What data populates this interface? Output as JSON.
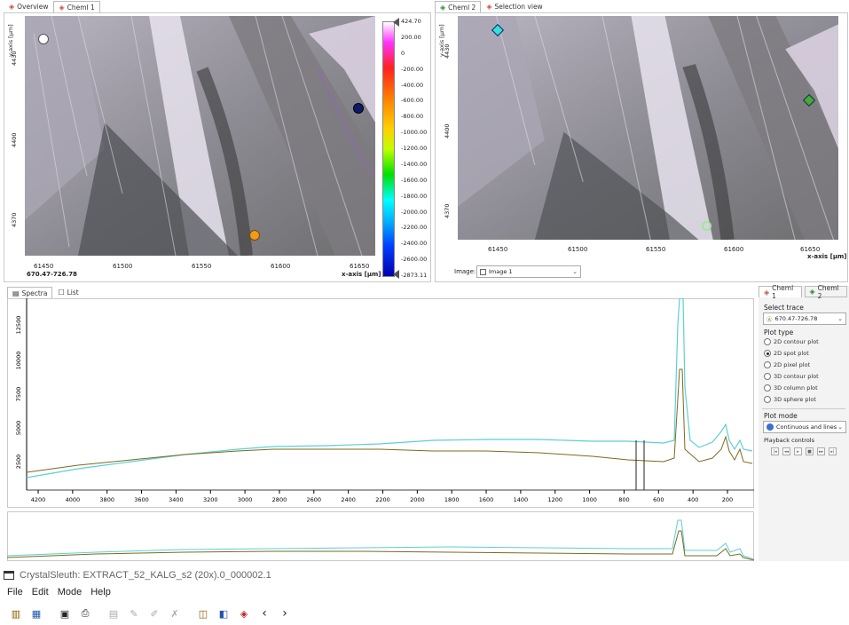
{
  "left_panel": {
    "tabs": [
      {
        "label": "Overview",
        "active": false
      },
      {
        "label": "Cheml 1",
        "active": true
      }
    ],
    "y_axis_label": "y-axis [µm]",
    "y_ticks": [
      "4430",
      "4400",
      "4370"
    ],
    "x_ticks": [
      "61450",
      "61500",
      "61550",
      "61600",
      "61650"
    ],
    "x_axis_label": "x-axis [µm]",
    "cursor_readout": "670.47-726.78",
    "colorbar_labels": [
      "424.70",
      "200.00",
      "0",
      "-200.00",
      "-400.00",
      "-600.00",
      "-800.00",
      "-1000.00",
      "-1200.00",
      "-1400.00",
      "-1600.00",
      "-1800.00",
      "-2000.00",
      "-2200.00",
      "-2400.00",
      "-2600.00",
      "-2873.11"
    ]
  },
  "right_panel": {
    "tabs": [
      {
        "label": "Cheml 2",
        "active": true
      },
      {
        "label": "Selection view",
        "active": false
      }
    ],
    "y_axis_label": "y-axis [µm]",
    "y_ticks": [
      "4430",
      "4400",
      "4370"
    ],
    "x_ticks": [
      "61450",
      "61500",
      "61550",
      "61600",
      "61650"
    ],
    "x_axis_label": "x-axis [µm]",
    "image_label": "Image:",
    "image_select": "Image 1"
  },
  "spectra_panel": {
    "tabs": [
      {
        "label": "Spectra",
        "active": true
      },
      {
        "label": "List",
        "active": false
      }
    ],
    "y_ticks": [
      "12500",
      "10000",
      "7500",
      "5000",
      "2500"
    ],
    "x_ticks": [
      "4200",
      "4000",
      "3800",
      "3600",
      "3400",
      "3200",
      "3000",
      "2800",
      "2600",
      "2400",
      "2200",
      "2000",
      "1800",
      "1600",
      "1400",
      "1200",
      "1000",
      "800",
      "600",
      "400",
      "200"
    ]
  },
  "side_panel": {
    "tabs": [
      {
        "label": "Cheml 1",
        "active": true
      },
      {
        "label": "Cheml 2",
        "active": false
      }
    ],
    "select_trace_label": "Select trace",
    "selected_trace": "670.47-726.78",
    "plot_type_label": "Plot type",
    "plot_types": [
      {
        "label": "2D contour plot",
        "checked": false
      },
      {
        "label": "2D spot plot",
        "checked": true
      },
      {
        "label": "2D pixel plot",
        "checked": false
      },
      {
        "label": "3D contour plot",
        "checked": false
      },
      {
        "label": "3D column plot",
        "checked": false
      },
      {
        "label": "3D sphere plot",
        "checked": false
      }
    ],
    "plot_mode_label": "Plot mode",
    "plot_mode": "Continuous and lines",
    "playback_label": "Playback controls"
  },
  "window": {
    "title": "CrystalSleuth: EXTRACT_52_KALG_s2 (20x).0_000002.1"
  },
  "menu": [
    "File",
    "Edit",
    "Mode",
    "Help"
  ],
  "colors": {
    "trace_cyan": "#5ccfd6",
    "trace_olive": "#7b6a1e",
    "marker_orange": "#f29a1a",
    "marker_navy": "#0d1a66",
    "marker_cyan": "#38e0d8",
    "marker_green": "#4aa83a"
  }
}
